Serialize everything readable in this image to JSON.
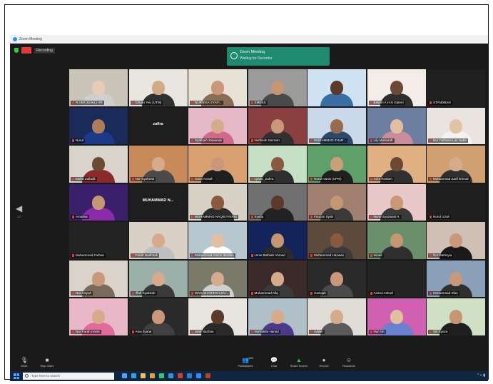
{
  "window": {
    "title": "Zoom Meeting",
    "recording_text": "Recording"
  },
  "notification": {
    "title": "Zoom Meeting",
    "subtitle": "Waiting for Recorder"
  },
  "pager": {
    "left_page": "1/2"
  },
  "participants": [
    {
      "name": "R.UMI (UniKL) HR",
      "bg": "#c9c5b8",
      "skin": "#e8cdb5",
      "shirt": "#cfcfcf",
      "speaking": true
    },
    {
      "name": "Chuan Yeo (UTM)",
      "bg": "#e9e6df",
      "skin": "#d3a987",
      "shirt": "#303030"
    },
    {
      "name": "NURNISA SYAFI...",
      "bg": "#e7e1d6",
      "skin": "#c99878",
      "shirt": "#8a6d55"
    },
    {
      "name": "SMEKS",
      "bg": "#9b9b9b",
      "skin": "#c69572",
      "shirt": "#4a4a4a"
    },
    {
      "name": "",
      "bg": "#cfe3f2",
      "skin": "#5b3a29",
      "shirt": "#3b6ea5"
    },
    {
      "name": "Essam A.H.N Gateni",
      "bg": "#f2ede6",
      "skin": "#6a4a35",
      "shirt": "#2e2e2e"
    },
    {
      "name": "STANDBAN",
      "bg": "#202020",
      "text_only": true,
      "display": ""
    },
    {
      "name": "Nurul",
      "bg": "#1a2a5a",
      "skin": "#b07b58",
      "shirt": "#1b3a8a"
    },
    {
      "name": "",
      "bg": "#1e1e1e",
      "text_only": true,
      "display": "zafira"
    },
    {
      "name": "Syafiqah Zawanah",
      "bg": "#e6b9c8",
      "skin": "#d6ab8b",
      "shirt": "#d06a8a"
    },
    {
      "name": "Nurfarah Sazzuin",
      "bg": "#8a4040",
      "skin": "#c99878",
      "shirt": "#303030"
    },
    {
      "name": "MUHAMMAD ZHAR...",
      "bg": "#c9d9ea",
      "skin": "#9a6a4c",
      "shirt": "#2a4a6a"
    },
    {
      "name": "Lily Maisarah",
      "bg": "#6d7fa0",
      "skin": "#e0c0a0",
      "shirt": "#c98c9c"
    },
    {
      "name": "Nur Farhana Lus Jadia",
      "bg": "#e9e4df",
      "skin": "#e3c3a6",
      "shirt": "#f3f3f3"
    },
    {
      "name": "Mohd Zulfadli",
      "bg": "#d8d4cc",
      "skin": "#6a4a35",
      "shirt": "#8a2a2a"
    },
    {
      "name": "Nur Syahirah",
      "bg": "#c98a5a",
      "skin": "#d6ab8b",
      "shirt": "#4a4a4a"
    },
    {
      "name": "Sarai Anisah",
      "bg": "#d9a070",
      "skin": "#c99878",
      "shirt": "#1f1f1f"
    },
    {
      "name": "Lyana_Zahra",
      "bg": "#c5e0c5",
      "skin": "#8a5a3c",
      "shirt": "#2f2f2f"
    },
    {
      "name": "Nurul Hanis (UPM)",
      "bg": "#5f9f6a",
      "skin": "#c9a07a",
      "shirt": "#202020"
    },
    {
      "name": "Azra Roslam",
      "bg": "#e0b080",
      "skin": "#6a4a35",
      "shirt": "#303030"
    },
    {
      "name": "Muhammad Zarif Ikhmal",
      "bg": "#d0a070",
      "skin": "#d6ab8b",
      "shirt": "#2f2f2f"
    },
    {
      "name": "Amalina",
      "bg": "#3a1f6a",
      "skin": "#c69572",
      "shirt": "#8a2aaa"
    },
    {
      "name": "",
      "bg": "#1e1e1e",
      "text_only": true,
      "display": "MUHAMMAD N..."
    },
    {
      "name": "MUHAMMAD NAQIB FIKRIE",
      "bg": "#d8d2c6",
      "skin": "#8a5a3c",
      "shirt": "#2b2b2b"
    },
    {
      "name": "Syafiq",
      "bg": "#707070",
      "skin": "#5a3a28",
      "shirt": "#222"
    },
    {
      "name": "Fauzan Syah",
      "bg": "#a08070",
      "skin": "#c69572",
      "shirt": "#3a3a3a"
    },
    {
      "name": "Nurul Syazwani A.",
      "bg": "#e8c8c8",
      "skin": "#c99878",
      "shirt": "#3a3a3a"
    },
    {
      "name": "Nurul Izzah",
      "bg": "#1e1e1e",
      "text_only": true,
      "display": ""
    },
    {
      "name": "Muhammad Farhan",
      "bg": "#232323",
      "text_only": true,
      "display": ""
    },
    {
      "name": "Farah Nadhirah",
      "bg": "#d9d0c6",
      "skin": "#d6ab8b",
      "shirt": "#c0c0c0"
    },
    {
      "name": "Muhammad Amirul Ibrahim",
      "bg": "#b7c7cf",
      "skin": "#e0c0a0",
      "shirt": "#ffffff"
    },
    {
      "name": "Umie Bathiah Ahmad",
      "bg": "#13245a",
      "skin": "#c69572",
      "shirt": "#2b2b2b"
    },
    {
      "name": "Muhammad Hazwan",
      "bg": "#5c4a3a",
      "skin": "#8a5a3c",
      "shirt": "#3a3a3a"
    },
    {
      "name": "Ismail",
      "bg": "#6a8f6a",
      "skin": "#c69572",
      "shirt": "#2f2f2f"
    },
    {
      "name": "Nur Batrisyia",
      "bg": "#cfbfb5",
      "skin": "#c99878",
      "shirt": "#1a1a1a"
    },
    {
      "name": "Nur Aisyah",
      "bg": "#d9d3ca",
      "skin": "#c99878",
      "shirt": "#7a6a5a"
    },
    {
      "name": "Iffah Syakirah",
      "bg": "#9bb0a8",
      "skin": "#d6ab8b",
      "shirt": "#3a3a3a"
    },
    {
      "name": "WAN SHARIFAH ZAI...",
      "bg": "#7a7a6a",
      "skin": "#d6ab8b",
      "shirt": "#d0d0d0"
    },
    {
      "name": "Muhammad Afiq",
      "bg": "#3a2a2a",
      "skin": "#d6ab8b",
      "shirt": "#3a3a3a"
    },
    {
      "name": "Haziqah",
      "bg": "#2a2a2a",
      "skin": "#c99878",
      "shirt": "#4a4a4a"
    },
    {
      "name": "Amirul Ashraf",
      "bg": "#232323",
      "text_only": true,
      "display": ""
    },
    {
      "name": "Muhammad Irfan",
      "bg": "#8aa0b8",
      "skin": "#c99878",
      "shirt": "#2f2f2f"
    },
    {
      "name": "Nur Farah Hanis",
      "bg": "#e8b8c8",
      "skin": "#d6ab8b",
      "shirt": "#e06a9a"
    },
    {
      "name": "Aina Ilyana",
      "bg": "#2a2a2a",
      "skin": "#c99878",
      "shirt": "#404040"
    },
    {
      "name": "Amir Nazhan",
      "bg": "#e8e4de",
      "skin": "#5a3a28",
      "shirt": "#2a2a2a"
    },
    {
      "name": "Nurhalida Hamid",
      "bg": "#b0c0c8",
      "skin": "#d6ab8b",
      "shirt": "#4a3a8a"
    },
    {
      "name": "Adilah",
      "bg": "#e0dcd6",
      "skin": "#d6ab8b",
      "shirt": "#5a5a5a"
    },
    {
      "name": "Nur Ain",
      "bg": "#d060b0",
      "skin": "#e0c0a0",
      "shirt": "#6a80d0"
    },
    {
      "name": "Siti Syaza",
      "bg": "#cfe0c5",
      "skin": "#c69572",
      "shirt": "#1f1f1f"
    }
  ],
  "controls": [
    {
      "label": "Mute",
      "glyph": "🎙",
      "icon": "microphone-icon"
    },
    {
      "label": "Stop Video",
      "glyph": "■",
      "icon": "video-camera-icon"
    },
    {
      "label": "Participants",
      "glyph": "👥",
      "icon": "participants-icon",
      "badge": "109"
    },
    {
      "label": "Chat",
      "glyph": "💬",
      "icon": "chat-icon"
    },
    {
      "label": "Share Screen",
      "glyph": "▲",
      "icon": "share-screen-icon",
      "green": true
    },
    {
      "label": "Record",
      "glyph": "●",
      "icon": "record-icon"
    },
    {
      "label": "Reactions",
      "glyph": "☺",
      "icon": "reactions-icon"
    }
  ],
  "taskbar": {
    "search_placeholder": "Type here to search"
  }
}
